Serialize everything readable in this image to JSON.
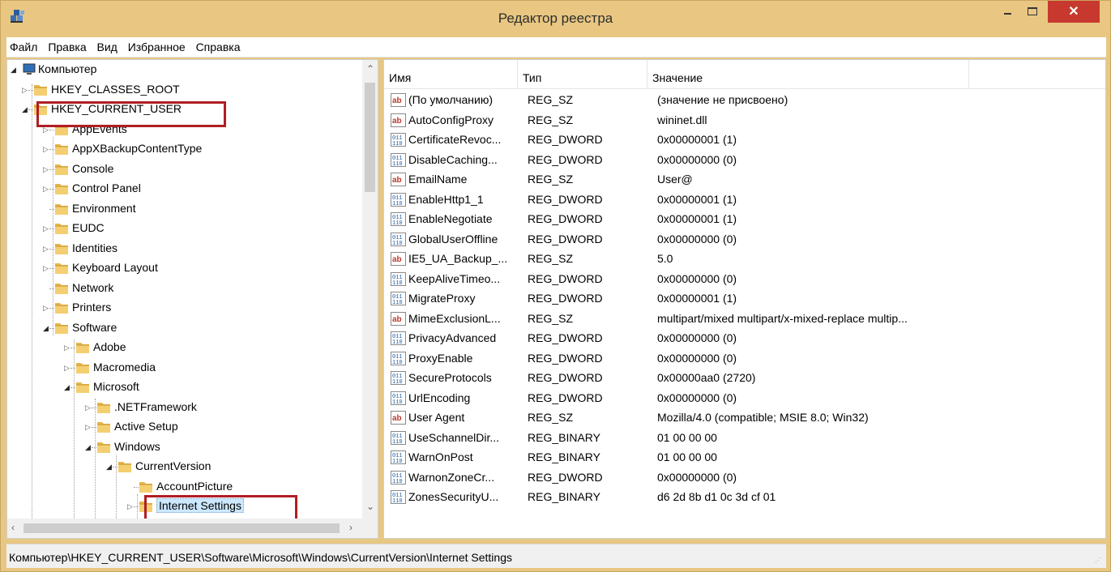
{
  "window": {
    "title": "Редактор реестра",
    "close_glyph": "✕"
  },
  "menu": [
    "Файл",
    "Правка",
    "Вид",
    "Избранное",
    "Справка"
  ],
  "tree": {
    "root_label": "Компьютер",
    "items": [
      {
        "label": "HKEY_CLASSES_ROOT",
        "level": 1,
        "state": "collapsed"
      },
      {
        "label": "HKEY_CURRENT_USER",
        "level": 1,
        "state": "expanded",
        "highlight": true
      },
      {
        "label": "AppEvents",
        "level": 2,
        "state": "collapsed"
      },
      {
        "label": "AppXBackupContentType",
        "level": 2,
        "state": "collapsed"
      },
      {
        "label": "Console",
        "level": 2,
        "state": "collapsed"
      },
      {
        "label": "Control Panel",
        "level": 2,
        "state": "collapsed"
      },
      {
        "label": "Environment",
        "level": 2,
        "state": "leaf"
      },
      {
        "label": "EUDC",
        "level": 2,
        "state": "collapsed"
      },
      {
        "label": "Identities",
        "level": 2,
        "state": "collapsed"
      },
      {
        "label": "Keyboard Layout",
        "level": 2,
        "state": "collapsed"
      },
      {
        "label": "Network",
        "level": 2,
        "state": "leaf"
      },
      {
        "label": "Printers",
        "level": 2,
        "state": "collapsed"
      },
      {
        "label": "Software",
        "level": 2,
        "state": "expanded"
      },
      {
        "label": "Adobe",
        "level": 3,
        "state": "collapsed"
      },
      {
        "label": "Macromedia",
        "level": 3,
        "state": "collapsed"
      },
      {
        "label": "Microsoft",
        "level": 3,
        "state": "expanded"
      },
      {
        "label": ".NETFramework",
        "level": 4,
        "state": "collapsed"
      },
      {
        "label": "Active Setup",
        "level": 4,
        "state": "collapsed"
      },
      {
        "label": "Windows",
        "level": 4,
        "state": "expanded"
      },
      {
        "label": "CurrentVersion",
        "level": 5,
        "state": "expanded"
      },
      {
        "label": "AccountPicture",
        "level": 6,
        "state": "leaf"
      },
      {
        "label": "Internet Settings",
        "level": 6,
        "state": "collapsed",
        "selected": true,
        "highlight": true
      }
    ]
  },
  "list": {
    "columns": [
      "Имя",
      "Тип",
      "Значение"
    ],
    "rows": [
      {
        "icon": "string-value-icon",
        "name": "(По умолчанию)",
        "type": "REG_SZ",
        "value": "(значение не присвоено)"
      },
      {
        "icon": "string-value-icon",
        "name": "AutoConfigProxy",
        "type": "REG_SZ",
        "value": "wininet.dll"
      },
      {
        "icon": "binary-value-icon",
        "name": "CertificateRevoc...",
        "type": "REG_DWORD",
        "value": "0x00000001 (1)"
      },
      {
        "icon": "binary-value-icon",
        "name": "DisableCaching...",
        "type": "REG_DWORD",
        "value": "0x00000000 (0)"
      },
      {
        "icon": "string-value-icon",
        "name": "EmailName",
        "type": "REG_SZ",
        "value": "User@"
      },
      {
        "icon": "binary-value-icon",
        "name": "EnableHttp1_1",
        "type": "REG_DWORD",
        "value": "0x00000001 (1)"
      },
      {
        "icon": "binary-value-icon",
        "name": "EnableNegotiate",
        "type": "REG_DWORD",
        "value": "0x00000001 (1)"
      },
      {
        "icon": "binary-value-icon",
        "name": "GlobalUserOffline",
        "type": "REG_DWORD",
        "value": "0x00000000 (0)"
      },
      {
        "icon": "string-value-icon",
        "name": "IE5_UA_Backup_...",
        "type": "REG_SZ",
        "value": "5.0"
      },
      {
        "icon": "binary-value-icon",
        "name": "KeepAliveTimeo...",
        "type": "REG_DWORD",
        "value": "0x00000000 (0)"
      },
      {
        "icon": "binary-value-icon",
        "name": "MigrateProxy",
        "type": "REG_DWORD",
        "value": "0x00000001 (1)"
      },
      {
        "icon": "string-value-icon",
        "name": "MimeExclusionL...",
        "type": "REG_SZ",
        "value": "multipart/mixed multipart/x-mixed-replace multip..."
      },
      {
        "icon": "binary-value-icon",
        "name": "PrivacyAdvanced",
        "type": "REG_DWORD",
        "value": "0x00000000 (0)"
      },
      {
        "icon": "binary-value-icon",
        "name": "ProxyEnable",
        "type": "REG_DWORD",
        "value": "0x00000000 (0)"
      },
      {
        "icon": "binary-value-icon",
        "name": "SecureProtocols",
        "type": "REG_DWORD",
        "value": "0x00000aa0 (2720)"
      },
      {
        "icon": "binary-value-icon",
        "name": "UrlEncoding",
        "type": "REG_DWORD",
        "value": "0x00000000 (0)"
      },
      {
        "icon": "string-value-icon",
        "name": "User Agent",
        "type": "REG_SZ",
        "value": "Mozilla/4.0 (compatible; MSIE 8.0; Win32)"
      },
      {
        "icon": "binary-value-icon",
        "name": "UseSchannelDir...",
        "type": "REG_BINARY",
        "value": "01 00 00 00"
      },
      {
        "icon": "binary-value-icon",
        "name": "WarnOnPost",
        "type": "REG_BINARY",
        "value": "01 00 00 00"
      },
      {
        "icon": "binary-value-icon",
        "name": "WarnonZoneCr...",
        "type": "REG_DWORD",
        "value": "0x00000000 (0)"
      },
      {
        "icon": "binary-value-icon",
        "name": "ZonesSecurityU...",
        "type": "REG_BINARY",
        "value": "d6 2d 8b d1 0c 3d cf 01"
      }
    ]
  },
  "status": {
    "path": "Компьютер\\HKEY_CURRENT_USER\\Software\\Microsoft\\Windows\\CurrentVersion\\Internet Settings"
  },
  "colors": {
    "frame": "#e7c784",
    "close": "#c7392e",
    "highlight_box": "#b01e23",
    "selection": "#cce8ff"
  }
}
